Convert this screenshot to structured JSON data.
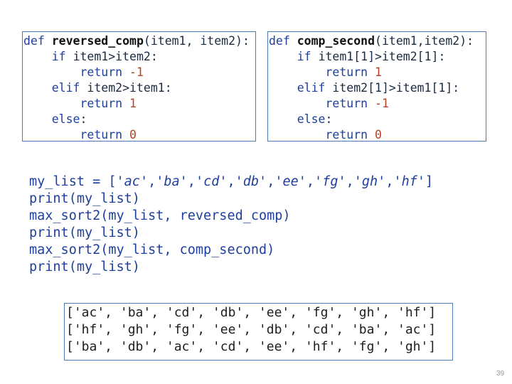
{
  "left_code": {
    "line1": {
      "kw": "def ",
      "name": "reversed_comp",
      "rest": "(item1, item2):"
    },
    "line2": {
      "indent": "    ",
      "kw": "if ",
      "rest": "item1>item2:"
    },
    "line3": {
      "indent": "        ",
      "kw": "return ",
      "num": "-1"
    },
    "line4": {
      "indent": "    ",
      "kw": "elif ",
      "rest": "item2>item1:"
    },
    "line5": {
      "indent": "        ",
      "kw": "return ",
      "num": "1"
    },
    "line6": {
      "indent": "    ",
      "kw": "else",
      "rest": ":"
    },
    "line7": {
      "indent": "        ",
      "kw": "return ",
      "num": "0"
    }
  },
  "right_code": {
    "line1": {
      "kw": "def ",
      "name": "comp_second",
      "rest": "(item1,item2):"
    },
    "line2": {
      "indent": "    ",
      "kw": "if ",
      "rest": "item1[1]>item2[1]:"
    },
    "line3": {
      "indent": "        ",
      "kw": "return ",
      "num": "1"
    },
    "line4": {
      "indent": "    ",
      "kw": "elif ",
      "rest": "item2[1]>item1[1]:"
    },
    "line5": {
      "indent": "        ",
      "kw": "return ",
      "num": "-1"
    },
    "line6": {
      "indent": "    ",
      "kw": "else",
      "rest": ":"
    },
    "line7": {
      "indent": "        ",
      "kw": "return ",
      "num": "0"
    }
  },
  "main_code": {
    "line1_prefix": "my_list = [",
    "list_items": [
      "'ac'",
      "'ba'",
      "'cd'",
      "'db'",
      "'ee'",
      "'fg'",
      "'gh'",
      "'hf'"
    ],
    "line1_suffix": "]",
    "line2": "print(my_list)",
    "line3": "max_sort2(my_list, reversed_comp)",
    "line4": "print(my_list)",
    "line5": "max_sort2(my_list, comp_second)",
    "line6": "print(my_list)"
  },
  "output": {
    "line1": "['ac', 'ba', 'cd', 'db', 'ee', 'fg', 'gh', 'hf']",
    "line2": "['hf', 'gh', 'fg', 'ee', 'db', 'cd', 'ba', 'ac']",
    "line3": "['ba', 'db', 'ac', 'cd', 'ee', 'hf', 'fg', 'gh']"
  },
  "page_number": "39"
}
